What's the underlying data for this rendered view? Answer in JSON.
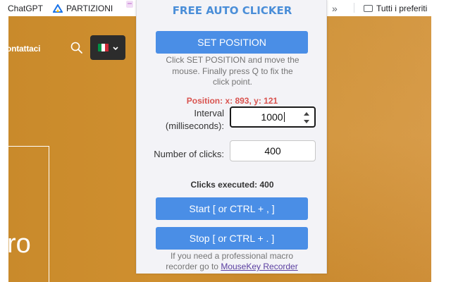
{
  "bookmarks": {
    "items": [
      {
        "label": "ChatGPT"
      },
      {
        "label": "PARTIZIONI"
      }
    ],
    "more_glyph": "»",
    "all_bookmarks_label": "Tutti i preferiti",
    "partizioni_icon_color": "#1a73e8",
    "folded_icon_color": "#d7a3e0"
  },
  "website": {
    "nav_contact_label": "ontattaci",
    "search_icon": "search-icon",
    "language_button": {
      "flag": "italy-flag-icon",
      "chevron": "chevron-down-icon"
    },
    "hero_text": "ro",
    "background_color": "#c98a2b"
  },
  "clicker": {
    "title": "FREE AUTO CLICKER",
    "set_position_label": "SET POSITION",
    "instructions": "Click SET POSITION and move the mouse. Finally press Q to fix the click point.",
    "position_readout": "Position: x: 893, y: 121",
    "interval_label": "Interval (milliseconds):",
    "interval_value": "1000",
    "clicks_label": "Number of clicks:",
    "clicks_value": "400",
    "clicks_executed": "Clicks executed: 400",
    "start_label": "Start [ or CTRL + , ]",
    "stop_label": "Stop [ or CTRL + . ]",
    "footer_text": "If you need a professional macro recorder go to",
    "footer_link_label": "MouseKey Recorder",
    "accent_color": "#4a8ee6",
    "position_color": "#d9534f"
  }
}
